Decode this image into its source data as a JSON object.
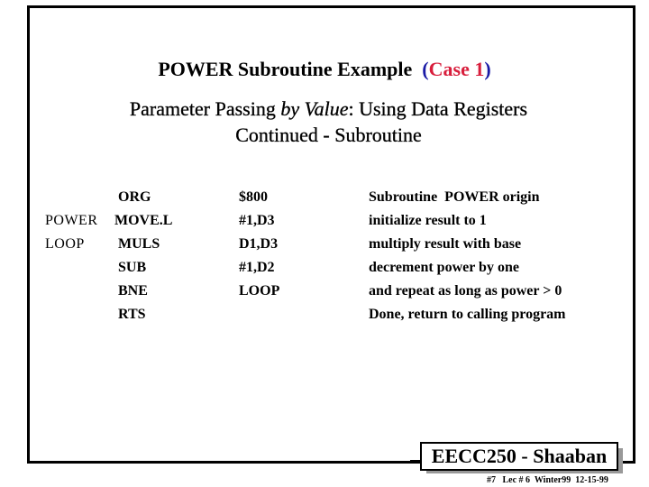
{
  "slide": {
    "title_main": "POWER Subroutine Example",
    "title_case_open": "(",
    "title_case_text": "Case 1",
    "title_case_close": ")",
    "subtitle_prefix": "Parameter Passing ",
    "subtitle_emphasis": "by Value",
    "subtitle_suffix": ": Using Data Registers",
    "subtitle_line2": "Continued  -  Subroutine",
    "colors": {
      "paren": "#1a1aa6",
      "case": "#d81e3c",
      "shadow": "#999999"
    }
  },
  "code": {
    "rows": [
      {
        "label": "",
        "op": "ORG",
        "arg": "$800",
        "comment": "Subroutine  POWER origin"
      },
      {
        "label": "POWER",
        "op": "MOVE.L",
        "arg": "#1,D3",
        "comment": "initialize result to 1"
      },
      {
        "label": "LOOP",
        "op": "MULS",
        "arg": "D1,D3",
        "comment": "multiply result with base"
      },
      {
        "label": "",
        "op": "SUB",
        "arg": "#1,D2",
        "comment": "decrement power by one"
      },
      {
        "label": "",
        "op": "BNE",
        "arg": "LOOP",
        "comment": "and repeat as long as power > 0"
      },
      {
        "label": "",
        "op": "RTS",
        "arg": "",
        "comment": "Done, return to calling program"
      }
    ]
  },
  "footer": {
    "badge": "EECC250 - Shaaban",
    "info": "#7   Lec # 6  Winter99  12-15-99"
  }
}
